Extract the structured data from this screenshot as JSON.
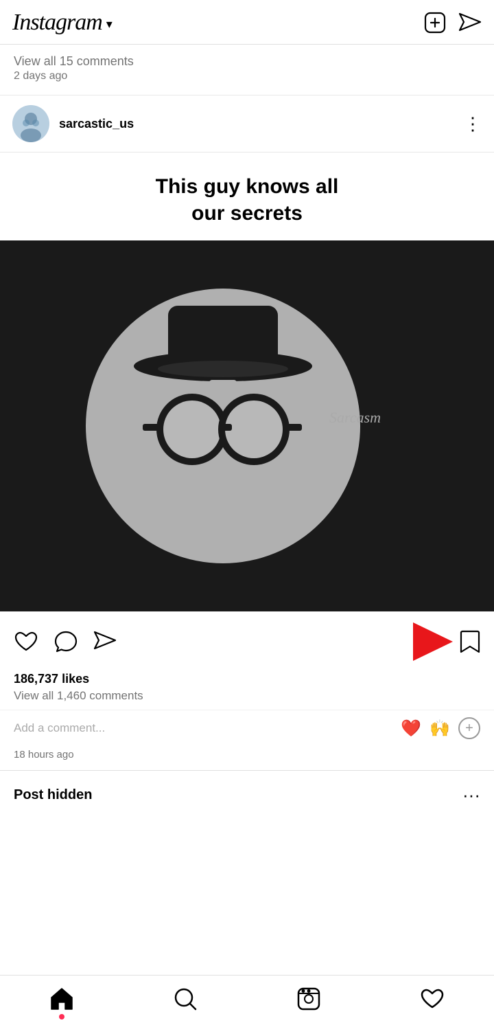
{
  "header": {
    "logo": "Instagram",
    "chevron": "▾",
    "create_icon_label": "create-plus-icon",
    "direct_icon_label": "direct-messages-icon"
  },
  "prev_post": {
    "view_comments": "View all 15 comments",
    "time_ago": "2 days ago"
  },
  "post": {
    "username": "sarcastic_us",
    "caption_line1": "This guy knows all",
    "caption_line2": "our secrets",
    "image_label": "Sarcasm",
    "likes": "186,737 likes",
    "view_comments": "View all 1,460 comments",
    "add_comment_placeholder": "Add a comment...",
    "time_ago": "18 hours ago",
    "emoji1": "❤️",
    "emoji2": "🙌"
  },
  "hidden_post": {
    "text": "Post hidden"
  },
  "bottom_nav": {
    "home_label": "Home",
    "search_label": "Search",
    "reels_label": "Reels",
    "activity_label": "Activity"
  }
}
